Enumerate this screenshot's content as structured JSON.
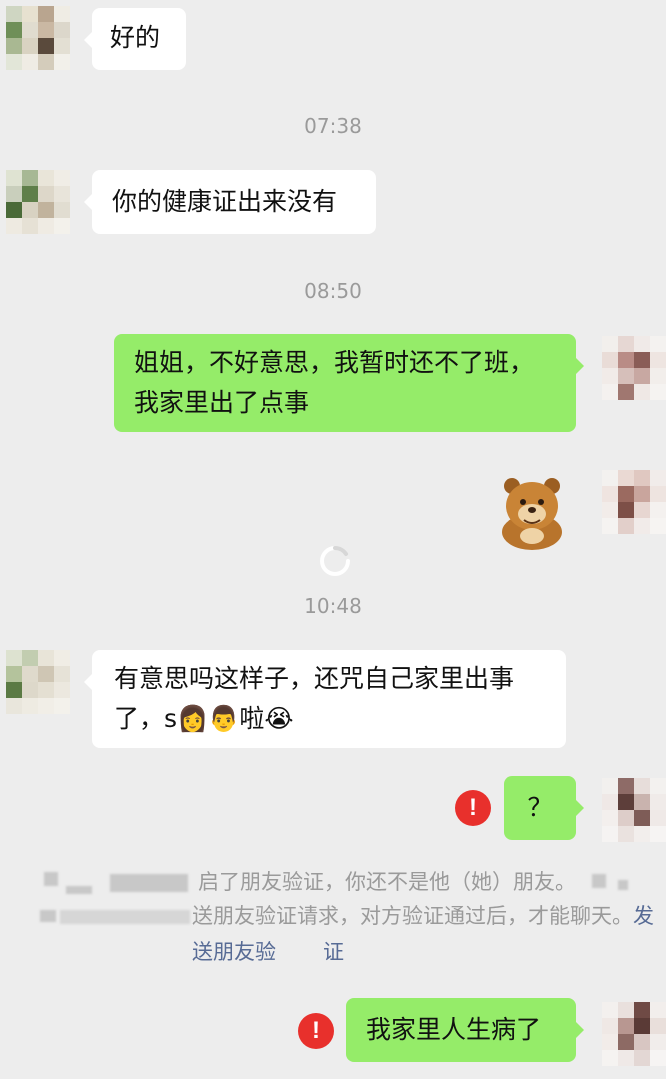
{
  "chat": {
    "messages": [
      {
        "text": "好的"
      },
      {
        "text": "你的健康证出来没有"
      },
      {
        "text": "姐姐，不好意思，我暂时还不了班，我家里出了点事"
      },
      {
        "text": "有意思吗这样子，还咒自己家里出事了，s",
        "tail": "啦"
      },
      {
        "text": "？"
      },
      {
        "text": "我家里人生病了"
      }
    ],
    "timestamps": [
      "07:38",
      "08:50",
      "10:48"
    ],
    "system": {
      "line1": "启了朋友验证，你还不是他（她）朋友。",
      "line2": "送朋友验证请求，对方验证通过后，才能聊天。",
      "link": "发送朋友验",
      "line3": "证"
    },
    "icons": {
      "error": "!",
      "emoji_girl": "👩",
      "emoji_man": "👨",
      "emoji_cry": "😭"
    },
    "colors": {
      "background": "#ededed",
      "bubble_sent": "#95ec69",
      "bubble_received": "#ffffff",
      "error_red": "#e8302c",
      "link_blue": "#576b95"
    }
  }
}
